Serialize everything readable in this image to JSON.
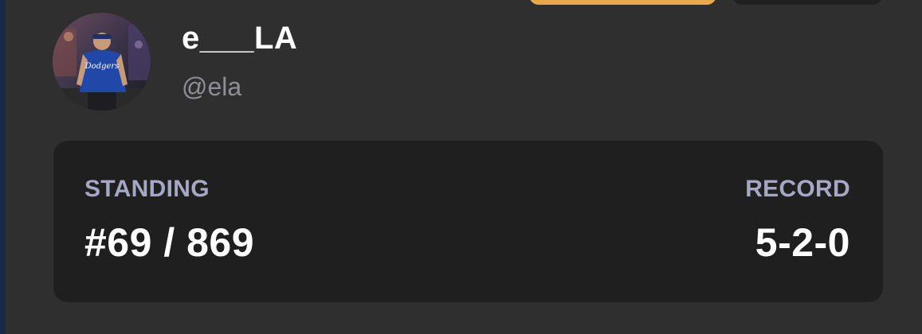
{
  "profile": {
    "display_name": "e___LA",
    "handle": "@ela",
    "avatar_alt": "Profile photo"
  },
  "stats": {
    "standing_label": "STANDING",
    "standing_value": "#69 / 869",
    "record_label": "RECORD",
    "record_value": "5-2-0"
  },
  "colors": {
    "background": "#2f2f30",
    "card": "#1f1f1f",
    "accent_button": "#e7aa4a",
    "label": "#a6a7c4",
    "handle": "#8e8e96"
  }
}
